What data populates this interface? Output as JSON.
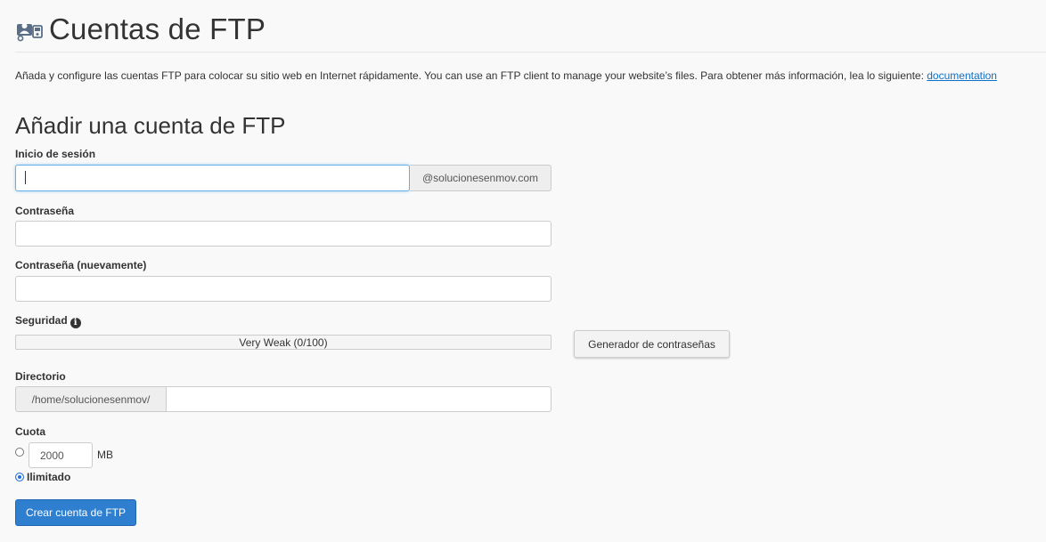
{
  "header": {
    "title": "Cuentas de FTP",
    "icon": "ftp-accounts-icon"
  },
  "description": {
    "text": "Añada y configure las cuentas FTP para colocar su sitio web en Internet rápidamente. You can use an FTP client to manage your website’s files. Para obtener más información, lea lo siguiente: ",
    "link_label": "documentation"
  },
  "form": {
    "section_title": "Añadir una cuenta de FTP",
    "login": {
      "label": "Inicio de sesión",
      "value": "",
      "domain_suffix": "@solucionesenmov.com"
    },
    "password": {
      "label": "Contraseña",
      "value": ""
    },
    "password_again": {
      "label": "Contraseña (nuevamente)",
      "value": ""
    },
    "security": {
      "label": "Seguridad",
      "strength_text": "Very Weak (0/100)",
      "strength_score": 0,
      "generator_button": "Generador de contraseñas"
    },
    "directory": {
      "label": "Directorio",
      "prefix": "/home/solucionesenmov/",
      "value": ""
    },
    "quota": {
      "label": "Cuota",
      "value": "2000",
      "unit": "MB",
      "unlimited_label": "Ilimitado",
      "selected": "unlimited"
    },
    "submit_button": "Crear cuenta de FTP"
  },
  "colors": {
    "primary": "#2e7fd0",
    "link": "#0e70c7",
    "focus": "#66afe9"
  }
}
